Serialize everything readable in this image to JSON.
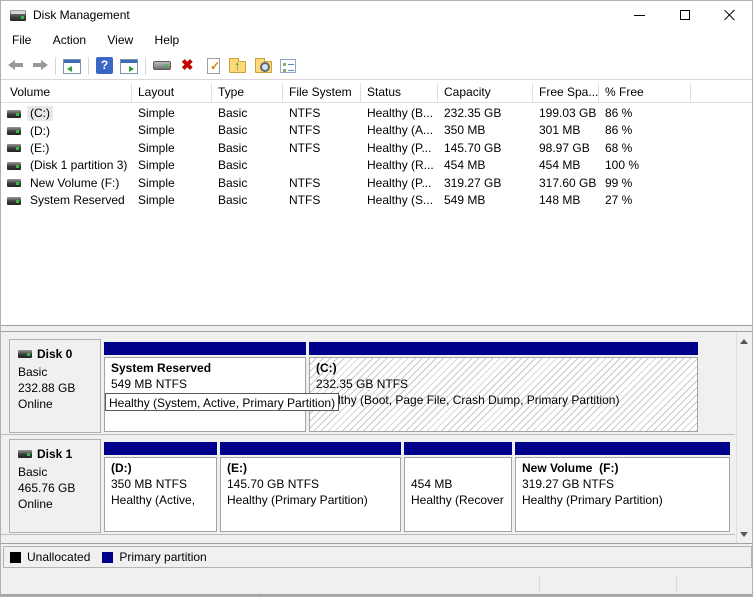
{
  "window": {
    "title": "Disk Management"
  },
  "menu": {
    "items": [
      "File",
      "Action",
      "View",
      "Help"
    ]
  },
  "toolbar": {
    "icons": [
      "back",
      "forward",
      "show-console-tree",
      "help",
      "show-action-pane",
      "rescan-disks",
      "delete-volume",
      "check-document",
      "folder-up",
      "explore-folder",
      "properties-list"
    ]
  },
  "volume_table": {
    "columns": [
      "Volume",
      "Layout",
      "Type",
      "File System",
      "Status",
      "Capacity",
      "Free Spa...",
      "% Free"
    ],
    "rows": [
      {
        "volume": "(C:)",
        "layout": "Simple",
        "type": "Basic",
        "fs": "NTFS",
        "status": "Healthy (B...",
        "capacity": "232.35 GB",
        "free": "199.03 GB",
        "pct": "86 %",
        "selected": true
      },
      {
        "volume": "(D:)",
        "layout": "Simple",
        "type": "Basic",
        "fs": "NTFS",
        "status": "Healthy (A...",
        "capacity": "350 MB",
        "free": "301 MB",
        "pct": "86 %",
        "selected": false
      },
      {
        "volume": "(E:)",
        "layout": "Simple",
        "type": "Basic",
        "fs": "NTFS",
        "status": "Healthy (P...",
        "capacity": "145.70 GB",
        "free": "98.97 GB",
        "pct": "68 %",
        "selected": false
      },
      {
        "volume": "(Disk 1 partition 3)",
        "layout": "Simple",
        "type": "Basic",
        "fs": "",
        "status": "Healthy (R...",
        "capacity": "454 MB",
        "free": "454 MB",
        "pct": "100 %",
        "selected": false
      },
      {
        "volume": "New Volume (F:)",
        "layout": "Simple",
        "type": "Basic",
        "fs": "NTFS",
        "status": "Healthy (P...",
        "capacity": "319.27 GB",
        "free": "317.60 GB",
        "pct": "99 %",
        "selected": false
      },
      {
        "volume": "System Reserved",
        "layout": "Simple",
        "type": "Basic",
        "fs": "NTFS",
        "status": "Healthy (S...",
        "capacity": "549 MB",
        "free": "148 MB",
        "pct": "27 %",
        "selected": false
      }
    ]
  },
  "disks": [
    {
      "name": "Disk 0",
      "kind": "Basic",
      "size": "232.88 GB",
      "status": "Online",
      "tooltip": "Healthy (System, Active, Primary Partition)",
      "partitions": [
        {
          "name": "System Reserved",
          "info": "549 MB NTFS",
          "status": ""
        },
        {
          "name": "(C:)",
          "info": "232.35 GB NTFS",
          "status": "Healthy (Boot, Page File, Crash Dump, Primary Partition)"
        }
      ]
    },
    {
      "name": "Disk 1",
      "kind": "Basic",
      "size": "465.76 GB",
      "status": "Online",
      "tooltip": "",
      "partitions": [
        {
          "name": "(D:)",
          "info": "350 MB NTFS",
          "status": "Healthy (Active,"
        },
        {
          "name": "(E:)",
          "info": "145.70 GB NTFS",
          "status": "Healthy (Primary Partition)"
        },
        {
          "name": "",
          "info": "454 MB",
          "status": "Healthy (Recover"
        },
        {
          "name": "New Volume  (F:)",
          "info": "319.27 GB NTFS",
          "status": "Healthy (Primary Partition)"
        }
      ]
    }
  ],
  "legend": {
    "items": [
      {
        "label": "Unallocated",
        "color": "#000000"
      },
      {
        "label": "Primary partition",
        "color": "#00008b"
      }
    ]
  },
  "colors": {
    "primary_partition": "#00008b",
    "unallocated": "#000000",
    "selection_gray": "#e8e8e8"
  }
}
